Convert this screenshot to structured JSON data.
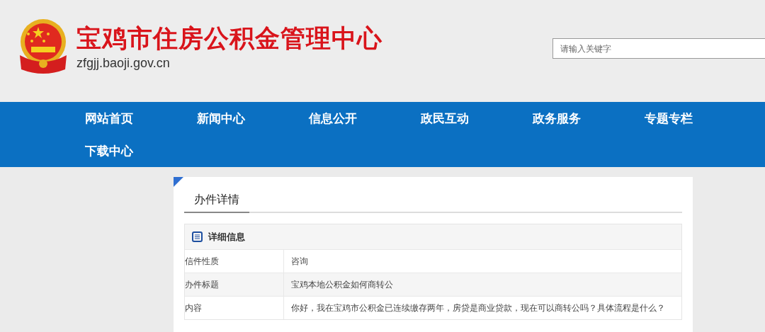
{
  "header": {
    "title": "宝鸡市住房公积金管理中心",
    "domain": "zfgjj.baoji.gov.cn"
  },
  "search": {
    "placeholder": "请输入关键字"
  },
  "nav": {
    "items": [
      {
        "label": "网站首页"
      },
      {
        "label": "新闻中心"
      },
      {
        "label": "信息公开"
      },
      {
        "label": "政民互动"
      },
      {
        "label": "政务服务"
      },
      {
        "label": "专题专栏"
      },
      {
        "label": "下载中心"
      }
    ]
  },
  "tabs": [
    {
      "label": "办件详情",
      "selected": true
    }
  ],
  "details": {
    "heading": "详细信息",
    "rows": [
      {
        "label": "信件性质",
        "value": "咨询"
      },
      {
        "label": "办件标题",
        "value": "宝鸡本地公积金如何商转公"
      },
      {
        "label": "内容",
        "value": "你好，我在宝鸡市公积金已连续缴存两年，房贷是商业贷款，现在可以商转公吗？具体流程是什么？"
      }
    ]
  }
}
